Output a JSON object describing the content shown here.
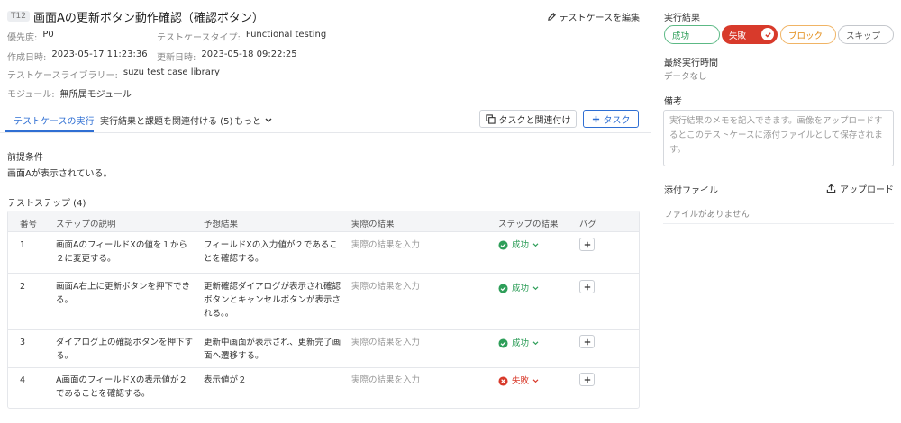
{
  "header": {
    "case_id": "T12",
    "title": "画面Aの更新ボタン動作確認（確認ボタン）",
    "edit_label": "テストケースを編集"
  },
  "meta": {
    "priority_label": "優先度:",
    "priority_value": "P0",
    "type_label": "テストケースタイプ:",
    "type_value": "Functional testing",
    "created_label": "作成日時:",
    "created_value": "2023-05-17 11:23:36",
    "updated_label": "更新日時:",
    "updated_value": "2023-05-18 09:22:25",
    "library_label": "テストケースライブラリー:",
    "library_value": "suzu test case library",
    "module_label": "モジュール:",
    "module_value": "無所属モジュール"
  },
  "tabs": {
    "run": "テストケースの実行",
    "link": "実行結果と課題を関連付ける (5)",
    "more": "もっと"
  },
  "actions": {
    "link_task": "タスクと関連付け",
    "add_task": "タスク"
  },
  "precondition": {
    "label": "前提条件",
    "text": "画面Aが表示されている。"
  },
  "steps": {
    "label": "テストステップ (4)",
    "columns": [
      "番号",
      "ステップの説明",
      "予想結果",
      "実際の結果",
      "ステップの結果",
      "バグ"
    ],
    "rows": [
      {
        "no": "1",
        "desc": [
          "画面AのフィールドXの値を１から",
          "２に変更する。"
        ],
        "expected": [
          "フィールドXの入力値が２であるこ",
          "とを確認する。"
        ],
        "actual_placeholder": "実際の結果を入力",
        "result": "成功",
        "status": "success"
      },
      {
        "no": "2",
        "desc": [
          "画面A右上に更新ボタンを押下でき",
          "る。"
        ],
        "expected": [
          "更新確認ダイアログが表示され確認",
          "ボタンとキャンセルボタンが表示さ",
          "れる。。"
        ],
        "actual_placeholder": "実際の結果を入力",
        "result": "成功",
        "status": "success"
      },
      {
        "no": "3",
        "desc": [
          "ダイアログ上の確認ボタンを押下す",
          "る。"
        ],
        "expected": [
          "更新中画面が表示され、更新完了画",
          "面へ遷移する。"
        ],
        "actual_placeholder": "実際の結果を入力",
        "result": "成功",
        "status": "success"
      },
      {
        "no": "4",
        "desc": [
          "A画面のフィールドXの表示値が２",
          "であることを確認する。"
        ],
        "expected": [
          "表示値が２"
        ],
        "actual_placeholder": "実際の結果を入力",
        "result": "失敗",
        "status": "fail"
      }
    ]
  },
  "sidebar": {
    "result_label": "実行結果",
    "pills": {
      "success": "成功",
      "fail": "失敗",
      "block": "ブロック",
      "skip": "スキップ"
    },
    "selected": "fail",
    "last_run_label": "最終実行時間",
    "last_run_value": "データなし",
    "memo_label": "備考",
    "memo_placeholder": "実行結果のメモを記入できます。画像をアップロードするとこのテストケースに添付ファイルとして保存されます。",
    "attach_label": "添付ファイル",
    "upload_label": "アップロード",
    "no_files": "ファイルがありません"
  },
  "colors": {
    "accent": "#2f6fd3",
    "success": "#2e9e59",
    "fail": "#d83a2b",
    "block": "#e28a13"
  }
}
